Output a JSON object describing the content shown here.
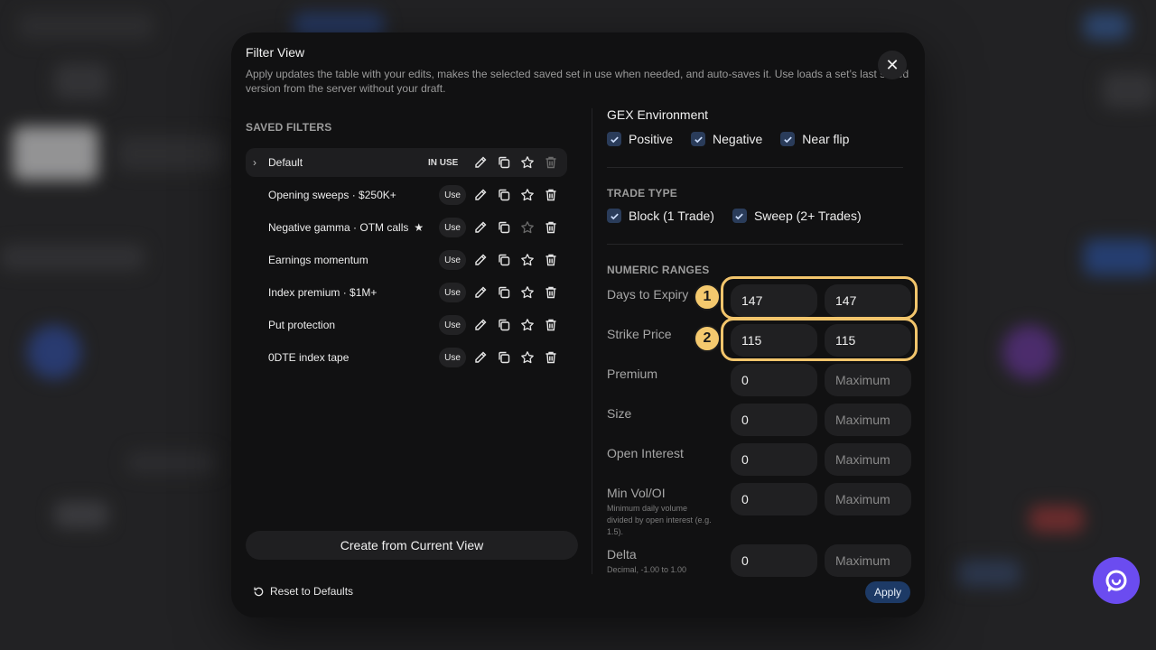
{
  "modal": {
    "title": "Filter View",
    "description": "Apply updates the table with your edits, makes the selected saved set in use when needed, and auto-saves it. Use loads a set’s last saved version from the server without your draft.",
    "close_icon": "close-icon"
  },
  "saved_filters": {
    "label": "SAVED FILTERS",
    "in_use_label": "IN USE",
    "use_label": "Use",
    "items": [
      {
        "name": "Default",
        "active": true,
        "favorite": false
      },
      {
        "name": "Opening sweeps · $250K+",
        "active": false,
        "favorite": false
      },
      {
        "name": "Negative gamma · OTM calls",
        "active": false,
        "favorite": true
      },
      {
        "name": "Earnings momentum",
        "active": false,
        "favorite": false
      },
      {
        "name": "Index premium · $1M+",
        "active": false,
        "favorite": false
      },
      {
        "name": "Put protection",
        "active": false,
        "favorite": false
      },
      {
        "name": "0DTE index tape",
        "active": false,
        "favorite": false
      }
    ],
    "create_label": "Create from Current View"
  },
  "footer": {
    "reset_label": "Reset to Defaults",
    "apply_label": "Apply"
  },
  "gex": {
    "title": "GEX Environment",
    "options": [
      {
        "label": "Positive",
        "checked": true
      },
      {
        "label": "Negative",
        "checked": true
      },
      {
        "label": "Near flip",
        "checked": true
      }
    ]
  },
  "trade_type": {
    "label": "TRADE TYPE",
    "options": [
      {
        "label": "Block (1 Trade)",
        "checked": true
      },
      {
        "label": "Sweep (2+ Trades)",
        "checked": true
      }
    ]
  },
  "numeric_ranges": {
    "label": "NUMERIC RANGES",
    "rows": [
      {
        "name": "Days to Expiry",
        "hint": "",
        "min": "147",
        "max": "147",
        "max_placeholder": "Maximum"
      },
      {
        "name": "Strike Price",
        "hint": "",
        "min": "115",
        "max": "115",
        "max_placeholder": "Maximum"
      },
      {
        "name": "Premium",
        "hint": "",
        "min": "0",
        "max": "",
        "max_placeholder": "Maximum"
      },
      {
        "name": "Size",
        "hint": "",
        "min": "0",
        "max": "",
        "max_placeholder": "Maximum"
      },
      {
        "name": "Open Interest",
        "hint": "",
        "min": "0",
        "max": "",
        "max_placeholder": "Maximum"
      },
      {
        "name": "Min Vol/OI",
        "hint": "Minimum daily volume divided by open interest (e.g. 1.5).",
        "min": "0",
        "max": "",
        "max_placeholder": "Maximum"
      },
      {
        "name": "Delta",
        "hint": "Decimal, -1.00 to 1.00",
        "min": "0",
        "max": "",
        "max_placeholder": "Maximum"
      }
    ]
  },
  "annotations": {
    "markers": [
      "1",
      "2"
    ],
    "highlight_color": "#f2c56c"
  },
  "colors": {
    "modal_bg": "#111112",
    "accent_blue": "#1d3a66",
    "checkbox_bg": "#2a3c5a",
    "chat_fab": "#6b4cf0"
  },
  "chat_fab_icon": "chat-bubble-icon"
}
